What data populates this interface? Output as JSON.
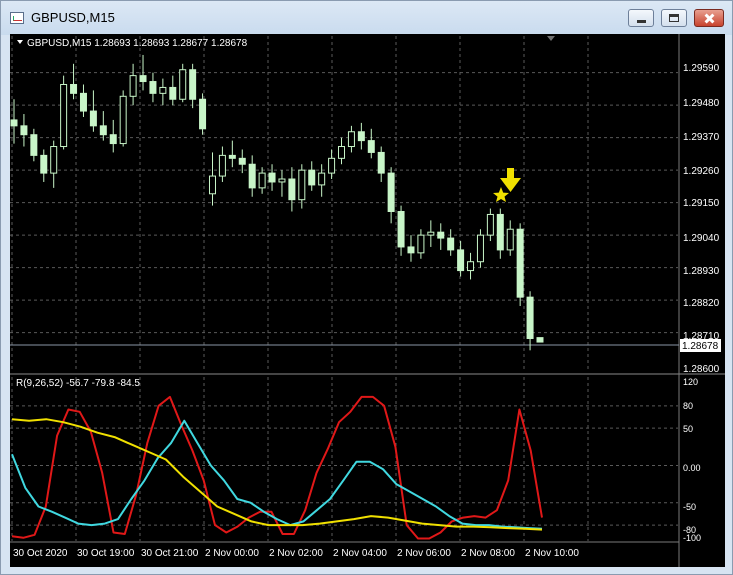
{
  "window": {
    "title": "GBPUSD,M15"
  },
  "chart_header": {
    "symbol_label": "GBPUSD,M15  1.28693 1.28693 1.28677 1.28678"
  },
  "price_axis": {
    "ticks": [
      "1.29590",
      "1.29480",
      "1.29370",
      "1.29260",
      "1.29150",
      "1.29040",
      "1.28930",
      "1.28820",
      "1.28710",
      "1.28600"
    ],
    "current_price": "1.28678"
  },
  "indicator": {
    "label": "R(9,26,52) -56.7 -79.8 -84.5",
    "ticks": [
      "120",
      "80",
      "50",
      "0.00",
      "-50",
      "-80",
      "-100"
    ]
  },
  "time_axis": {
    "ticks": [
      "30 Oct 2020",
      "30 Oct 19:00",
      "30 Oct 21:00",
      "2 Nov 00:00",
      "2 Nov 02:00",
      "2 Nov 04:00",
      "2 Nov 06:00",
      "2 Nov 08:00",
      "2 Nov 10:00"
    ]
  },
  "colors": {
    "background": "#000000",
    "candle": "#c8f5c8",
    "grid": "#5a5a5a",
    "line_red": "#e01818",
    "line_cyan": "#40d8e0",
    "line_yellow": "#f0e000",
    "arrow": "#f0e000"
  },
  "chart_data": {
    "type": "candlestick",
    "symbol": "GBPUSD",
    "timeframe": "M15",
    "price_range": [
      1.2858,
      1.2966
    ],
    "last": {
      "open": 1.28693,
      "high": 1.28693,
      "low": 1.28677,
      "close": 1.28678
    },
    "candles": [
      [
        1.2943,
        1.295,
        1.2935,
        1.2941
      ],
      [
        1.2941,
        1.2945,
        1.2934,
        1.2938
      ],
      [
        1.2938,
        1.294,
        1.2929,
        1.2931
      ],
      [
        1.2931,
        1.2933,
        1.2922,
        1.2925
      ],
      [
        1.2925,
        1.2936,
        1.292,
        1.2934
      ],
      [
        1.2934,
        1.2958,
        1.2933,
        1.2955
      ],
      [
        1.2955,
        1.2962,
        1.295,
        1.2952
      ],
      [
        1.2952,
        1.2955,
        1.2944,
        1.2946
      ],
      [
        1.2946,
        1.2953,
        1.2939,
        1.2941
      ],
      [
        1.2941,
        1.2946,
        1.2936,
        1.2938
      ],
      [
        1.2938,
        1.2943,
        1.2932,
        1.2935
      ],
      [
        1.2935,
        1.2953,
        1.2934,
        1.2951
      ],
      [
        1.2951,
        1.2962,
        1.2948,
        1.2958
      ],
      [
        1.2958,
        1.2965,
        1.2953,
        1.2956
      ],
      [
        1.2956,
        1.2959,
        1.2949,
        1.2952
      ],
      [
        1.2952,
        1.2957,
        1.2948,
        1.2954
      ],
      [
        1.2954,
        1.2958,
        1.2948,
        1.295
      ],
      [
        1.295,
        1.2962,
        1.2949,
        1.296
      ],
      [
        1.296,
        1.2962,
        1.2947,
        1.295
      ],
      [
        1.295,
        1.2952,
        1.2938,
        1.294
      ],
      [
        1.2918,
        1.2932,
        1.2914,
        1.2924
      ],
      [
        1.2924,
        1.2934,
        1.2922,
        1.2931
      ],
      [
        1.2931,
        1.2936,
        1.2927,
        1.293
      ],
      [
        1.293,
        1.2933,
        1.2925,
        1.2928
      ],
      [
        1.2928,
        1.2931,
        1.2917,
        1.292
      ],
      [
        1.292,
        1.2927,
        1.2918,
        1.2925
      ],
      [
        1.2925,
        1.2928,
        1.2919,
        1.2922
      ],
      [
        1.2922,
        1.2926,
        1.2917,
        1.2923
      ],
      [
        1.2923,
        1.2927,
        1.2912,
        1.2916
      ],
      [
        1.2916,
        1.2928,
        1.2913,
        1.2926
      ],
      [
        1.2926,
        1.2929,
        1.2919,
        1.2921
      ],
      [
        1.2921,
        1.2928,
        1.2917,
        1.2925
      ],
      [
        1.2925,
        1.2933,
        1.2923,
        1.293
      ],
      [
        1.293,
        1.2937,
        1.2928,
        1.2934
      ],
      [
        1.2934,
        1.2941,
        1.2932,
        1.2939
      ],
      [
        1.2939,
        1.2942,
        1.2933,
        1.2936
      ],
      [
        1.2936,
        1.294,
        1.293,
        1.2932
      ],
      [
        1.2932,
        1.2934,
        1.2922,
        1.2925
      ],
      [
        1.2925,
        1.2927,
        1.2908,
        1.2912
      ],
      [
        1.2912,
        1.2914,
        1.2897,
        1.29
      ],
      [
        1.29,
        1.2904,
        1.2895,
        1.2898
      ],
      [
        1.2898,
        1.2906,
        1.2896,
        1.2904
      ],
      [
        1.2904,
        1.2909,
        1.29,
        1.2905
      ],
      [
        1.2905,
        1.2908,
        1.2899,
        1.2903
      ],
      [
        1.2903,
        1.2906,
        1.2897,
        1.2899
      ],
      [
        1.2899,
        1.2902,
        1.289,
        1.2892
      ],
      [
        1.2892,
        1.2898,
        1.2889,
        1.2895
      ],
      [
        1.2895,
        1.2906,
        1.2893,
        1.2904
      ],
      [
        1.2904,
        1.2913,
        1.2902,
        1.2911
      ],
      [
        1.2911,
        1.2913,
        1.2896,
        1.2899
      ],
      [
        1.2899,
        1.2909,
        1.2897,
        1.2906
      ],
      [
        1.2906,
        1.2908,
        1.288,
        1.2883
      ],
      [
        1.2883,
        1.2885,
        1.2865,
        1.2869
      ],
      [
        1.28693,
        1.28693,
        1.28677,
        1.28678
      ]
    ],
    "oscillator": {
      "range": [
        -100,
        120
      ],
      "series": [
        {
          "color": "red",
          "values": [
            -95,
            -97,
            -93,
            -55,
            40,
            75,
            72,
            45,
            -10,
            -90,
            -92,
            -40,
            30,
            80,
            92,
            55,
            20,
            -20,
            -80,
            -90,
            -82,
            -70,
            -62,
            -62,
            -92,
            -92,
            -60,
            -10,
            22,
            58,
            72,
            92,
            92,
            80,
            25,
            -80,
            -98,
            -98,
            -90,
            -75,
            -70,
            -68,
            -70,
            -60,
            -20,
            75,
            20,
            -70
          ]
        },
        {
          "color": "cyan",
          "values": [
            15,
            -30,
            -55,
            -62,
            -70,
            -78,
            -80,
            -78,
            -72,
            -45,
            -20,
            10,
            30,
            60,
            30,
            0,
            -20,
            -45,
            -50,
            -62,
            -72,
            -80,
            -75,
            -60,
            -45,
            -20,
            5,
            5,
            -5,
            -25,
            -35,
            -45,
            -55,
            -68,
            -78,
            -80,
            -80,
            -82,
            -83,
            -84,
            -85
          ]
        },
        {
          "color": "yellow",
          "values": [
            62,
            60,
            62,
            58,
            52,
            44,
            38,
            28,
            18,
            8,
            -15,
            -35,
            -55,
            -65,
            -75,
            -80,
            -80,
            -80,
            -78,
            -75,
            -72,
            -68,
            -70,
            -74,
            -78,
            -80,
            -82,
            -82,
            -83,
            -84,
            -85,
            -86
          ]
        }
      ]
    }
  }
}
